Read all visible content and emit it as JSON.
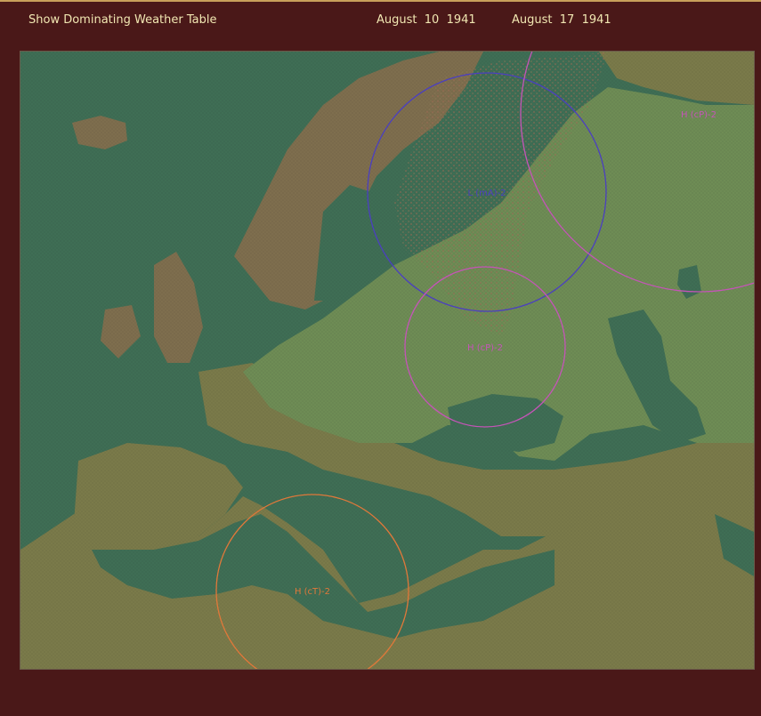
{
  "header": {
    "show_table_label": "Show Dominating Weather Table",
    "current_date": "August  10  1941",
    "next_date": "August  17  1941"
  },
  "map": {
    "colors": {
      "sea": "#3f6e55",
      "steppe_land": "#6e8c55",
      "dry_land": "#7a7a4a",
      "forest_land": "#7e6e4e"
    },
    "weather_systems": [
      {
        "label": "L (mA)-2",
        "color": "#4b3fc0"
      },
      {
        "label": "H (cP)-2",
        "color": "#c554b8"
      },
      {
        "label": "H (cP)-2",
        "color": "#c554b8"
      },
      {
        "label": "H (cT)-2",
        "color": "#e0783a"
      }
    ]
  }
}
